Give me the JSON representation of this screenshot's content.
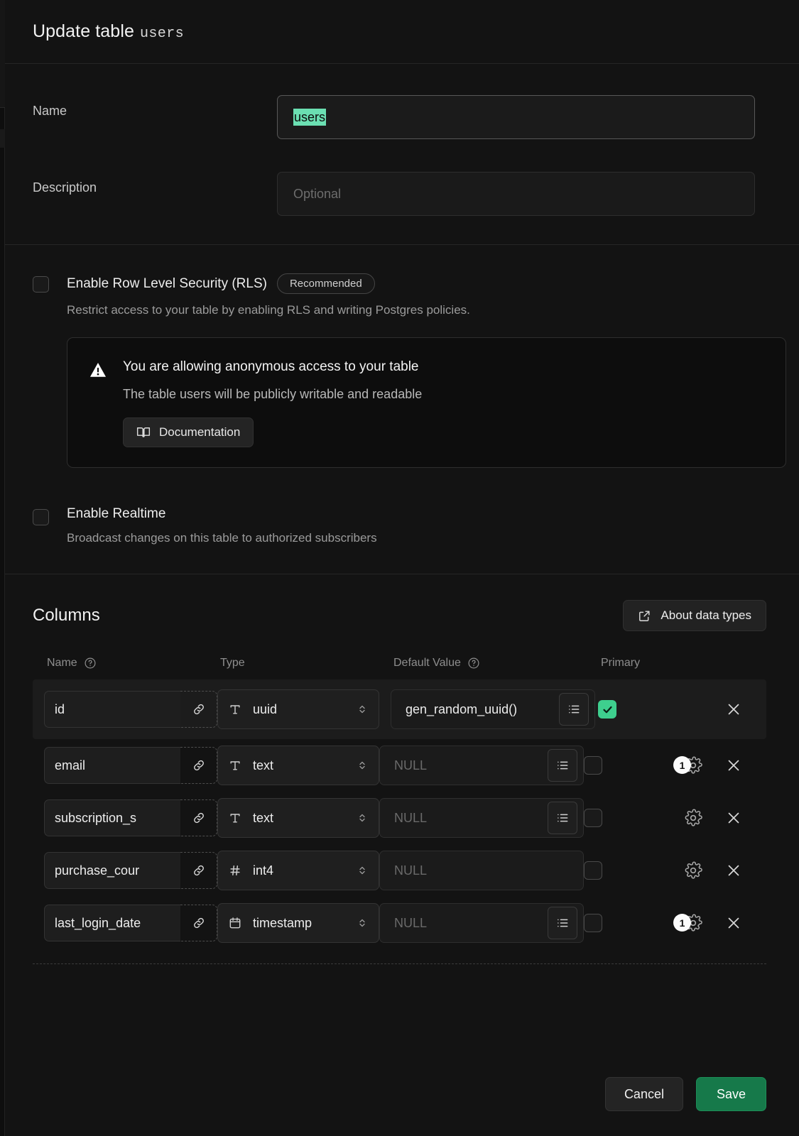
{
  "header": {
    "title": "Update table",
    "table_name": "users"
  },
  "form": {
    "name_label": "Name",
    "name_value": "users",
    "description_label": "Description",
    "description_value": "",
    "description_placeholder": "Optional"
  },
  "rls": {
    "title": "Enable Row Level Security (RLS)",
    "badge": "Recommended",
    "description": "Restrict access to your table by enabling RLS and writing Postgres policies.",
    "checked": false
  },
  "warning": {
    "icon": "warning-triangle-icon",
    "title": "You are allowing anonymous access to your table",
    "subtitle": "The table users will be publicly writable and readable",
    "button_label": "Documentation",
    "button_icon": "book-icon"
  },
  "realtime": {
    "title": "Enable Realtime",
    "description": "Broadcast changes on this table to authorized subscribers",
    "checked": false
  },
  "columns": {
    "section_title": "Columns",
    "about_button": "About data types",
    "about_icon": "external-link-icon",
    "headers": {
      "name": "Name",
      "type": "Type",
      "default_value": "Default Value",
      "primary": "Primary"
    },
    "rows": [
      {
        "name": "id",
        "type": "uuid",
        "type_icon": "text-type-icon",
        "default_value": "gen_random_uuid()",
        "default_is_null": false,
        "has_list_button": true,
        "primary": true,
        "highlighted": true,
        "has_gear": false,
        "gear_badge": "",
        "has_close": true
      },
      {
        "name": "email",
        "type": "text",
        "type_icon": "text-type-icon",
        "default_value": "NULL",
        "default_is_null": true,
        "has_list_button": true,
        "primary": false,
        "highlighted": false,
        "has_gear": true,
        "gear_badge": "1",
        "has_close": true
      },
      {
        "name": "subscription_s",
        "type": "text",
        "type_icon": "text-type-icon",
        "default_value": "NULL",
        "default_is_null": true,
        "has_list_button": true,
        "primary": false,
        "highlighted": false,
        "has_gear": true,
        "gear_badge": "",
        "has_close": true
      },
      {
        "name": "purchase_cour",
        "type": "int4",
        "type_icon": "number-type-icon",
        "default_value": "NULL",
        "default_is_null": true,
        "has_list_button": false,
        "primary": false,
        "highlighted": false,
        "has_gear": true,
        "gear_badge": "",
        "has_close": true
      },
      {
        "name": "last_login_date",
        "type": "timestamp",
        "type_icon": "calendar-type-icon",
        "default_value": "NULL",
        "default_is_null": true,
        "has_list_button": true,
        "primary": false,
        "highlighted": false,
        "has_gear": true,
        "gear_badge": "1",
        "has_close": true
      }
    ]
  },
  "footer": {
    "cancel_label": "Cancel",
    "save_label": "Save"
  },
  "colors": {
    "accent_green": "#3ecf8e",
    "save_green": "#16794a",
    "selection_green": "#6bdfb2",
    "panel_bg": "#131313",
    "row_highlight": "#1c1c1c"
  }
}
